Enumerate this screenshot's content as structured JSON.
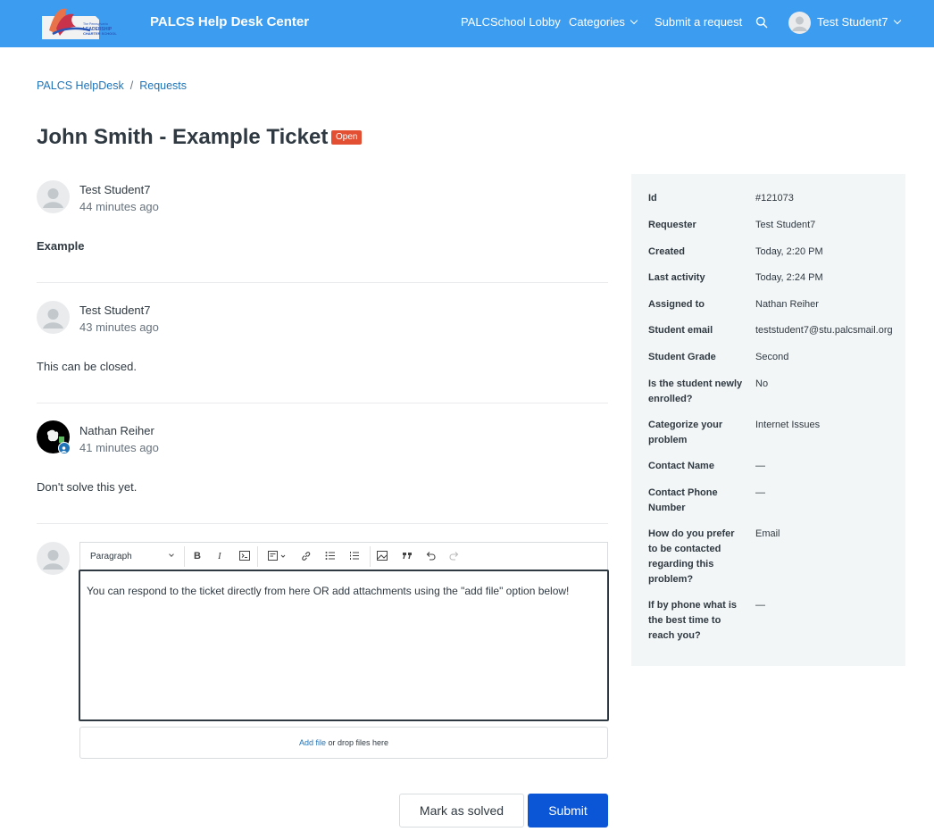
{
  "header": {
    "brand": "PALCS Help Desk Center",
    "logo_text": "The Pennsylvania LEADERSHIP CHARTER SCHOOL",
    "nav": {
      "lobby": "PALCSchool Lobby",
      "categories": "Categories",
      "submit_request": "Submit a request",
      "user": "Test Student7"
    }
  },
  "breadcrumb": {
    "home": "PALCS HelpDesk",
    "separator": "/",
    "requests": "Requests"
  },
  "ticket": {
    "title": "John Smith - Example Ticket",
    "status": "Open",
    "status_color": "#e34f32"
  },
  "comments": [
    {
      "author": "Test Student7",
      "time": "44 minutes ago",
      "body": "Example"
    },
    {
      "author": "Test Student7",
      "time": "43 minutes ago",
      "body": "This can be closed."
    },
    {
      "author": "Nathan Reiher",
      "time": "41 minutes ago",
      "body": "Don't solve this yet."
    }
  ],
  "editor": {
    "format": "Paragraph",
    "content": "You can respond to the ticket directly from here OR add attachments using the \"add file\" option below!",
    "add_file": "Add file",
    "drop_text": " or drop files here"
  },
  "actions": {
    "mark_solved": "Mark as solved",
    "submit": "Submit",
    "submit_color": "#0b56d6"
  },
  "details": [
    {
      "label": "Id",
      "value": "#121073"
    },
    {
      "label": "Requester",
      "value": "Test Student7"
    },
    {
      "label": "Created",
      "value": "Today, 2:20 PM"
    },
    {
      "label": "Last activity",
      "value": "Today, 2:24 PM"
    },
    {
      "label": "Assigned to",
      "value": "Nathan Reiher"
    },
    {
      "label": "Student email",
      "value": "teststudent7@stu.palcsmail.org"
    },
    {
      "label": "Student Grade",
      "value": "Second"
    },
    {
      "label": "Is the student newly enrolled?",
      "value": "No"
    },
    {
      "label": "Categorize your problem",
      "value": "Internet Issues"
    },
    {
      "label": "Contact Name",
      "value": "—"
    },
    {
      "label": "Contact Phone Number",
      "value": "—"
    },
    {
      "label": "How do you prefer to be contacted regarding this problem?",
      "value": "Email"
    },
    {
      "label": "If by phone what is the best time to reach you?",
      "value": "—"
    }
  ],
  "colors": {
    "header_bg": "#3c9df0",
    "link": "#1f73b7",
    "panel_bg": "#f3f6f7"
  }
}
